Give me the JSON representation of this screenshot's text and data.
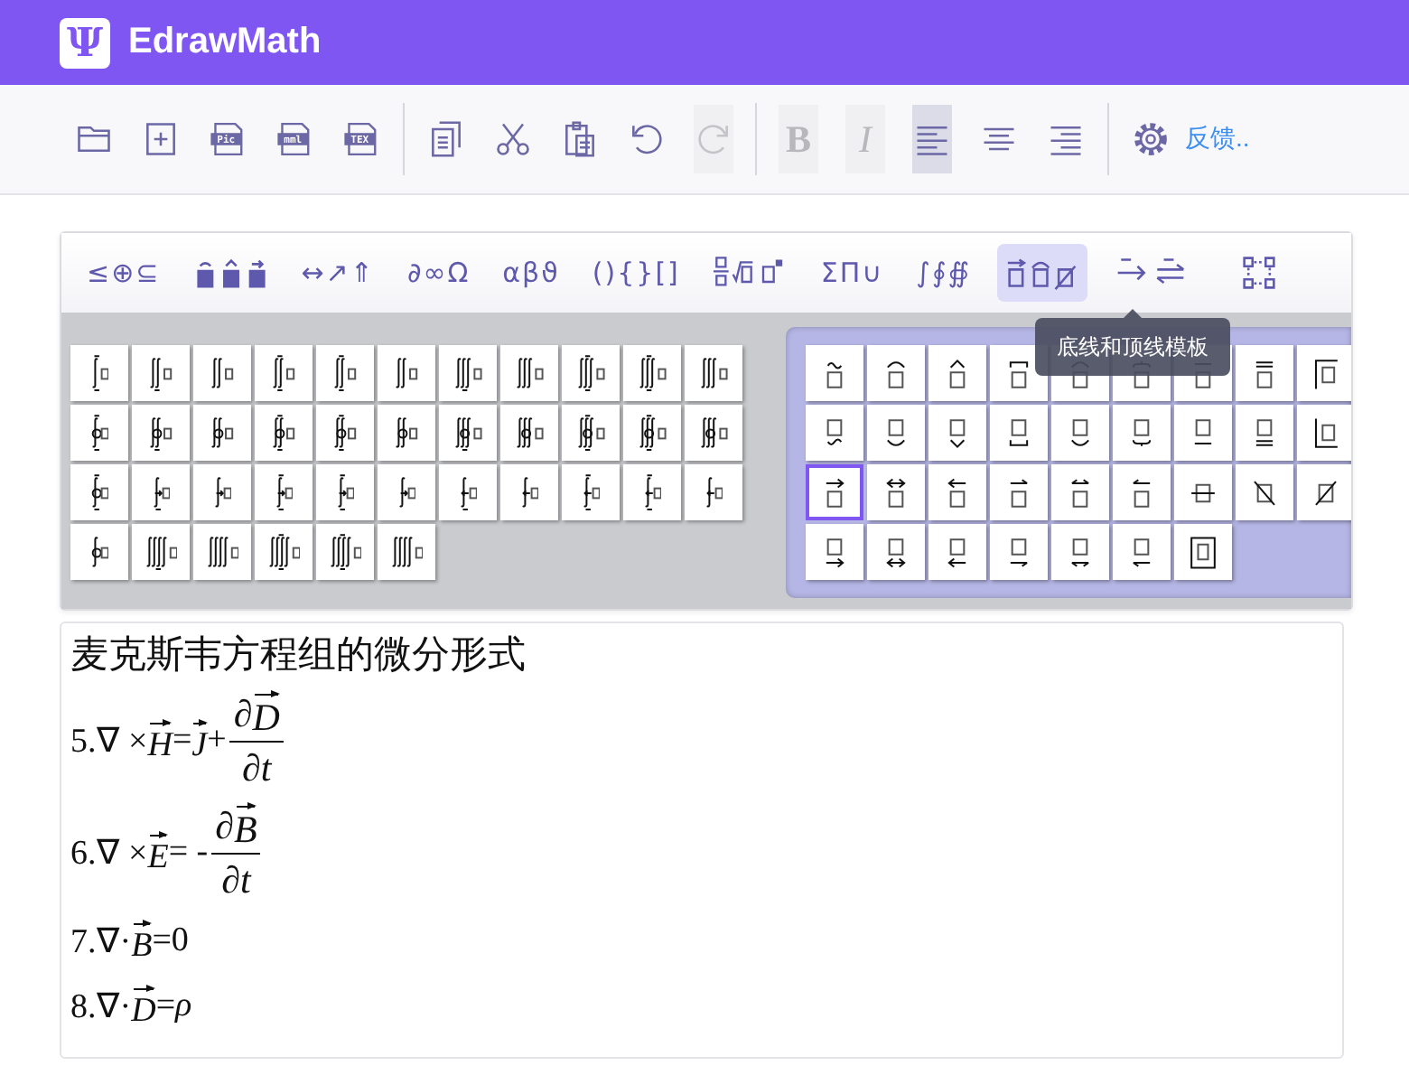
{
  "app": {
    "logo": "Ψ",
    "title": "EdrawMath"
  },
  "toolbar": {
    "tools": [
      {
        "kind": "open",
        "disabled": false
      },
      {
        "kind": "new",
        "disabled": false
      },
      {
        "kind": "export",
        "label": "Pic",
        "disabled": false
      },
      {
        "kind": "export",
        "label": "mml",
        "disabled": false
      },
      {
        "kind": "export",
        "label": "TEX",
        "disabled": false
      },
      {
        "kind": "separator"
      },
      {
        "kind": "copy",
        "disabled": false
      },
      {
        "kind": "cut",
        "disabled": false
      },
      {
        "kind": "paste",
        "disabled": false
      },
      {
        "kind": "undo",
        "disabled": false
      },
      {
        "kind": "redo",
        "disabled": true
      },
      {
        "kind": "separator"
      },
      {
        "kind": "bold",
        "label": "B",
        "disabled": true
      },
      {
        "kind": "italic",
        "label": "I",
        "disabled": true
      },
      {
        "kind": "align-left",
        "disabled": false,
        "selected": true
      },
      {
        "kind": "align-center",
        "disabled": false,
        "selected": false
      },
      {
        "kind": "align-right",
        "disabled": false,
        "selected": false
      },
      {
        "kind": "separator"
      },
      {
        "kind": "settings",
        "disabled": false
      }
    ],
    "feedback": "反馈.."
  },
  "symbol_tabs": [
    {
      "kind": "text",
      "label": "≤⊕⊆",
      "selected": false
    },
    {
      "kind": "accents",
      "selected": false
    },
    {
      "kind": "text",
      "label": "↔↗⇑",
      "selected": false
    },
    {
      "kind": "text",
      "label": "∂∞Ω",
      "selected": false
    },
    {
      "kind": "text",
      "label": "αβϑ",
      "selected": false
    },
    {
      "kind": "text",
      "label": "(){}[]",
      "selected": false
    },
    {
      "kind": "fractions",
      "selected": false
    },
    {
      "kind": "text",
      "label": "ΣΠ∪",
      "selected": false
    },
    {
      "kind": "text",
      "label": "∫∮∯",
      "selected": false
    },
    {
      "kind": "bars",
      "selected": true
    },
    {
      "kind": "labeled-arrows",
      "selected": false
    },
    {
      "kind": "matrices",
      "selected": false
    }
  ],
  "tooltip": "底线和顶线模板",
  "integral_templates": [
    {
      "selected": false
    },
    {
      "selected": false
    },
    {
      "selected": false
    },
    {
      "selected": false
    },
    {
      "selected": false
    },
    {
      "selected": false
    },
    {
      "selected": false
    },
    {
      "selected": false
    },
    {
      "selected": false
    },
    {
      "selected": false
    },
    {
      "selected": false
    },
    {
      "selected": false
    },
    {
      "selected": false
    },
    {
      "selected": false
    },
    {
      "selected": false
    },
    {
      "selected": false
    },
    {
      "selected": false
    },
    {
      "selected": false
    },
    {
      "selected": false
    },
    {
      "selected": false
    },
    {
      "selected": false
    },
    {
      "selected": false
    },
    {
      "selected": false
    },
    {
      "selected": false
    },
    {
      "selected": false
    },
    {
      "selected": false
    },
    {
      "selected": false
    },
    {
      "selected": false
    },
    {
      "selected": false
    },
    {
      "selected": false
    },
    {
      "selected": false
    },
    {
      "selected": false
    },
    {
      "selected": false
    },
    {
      "selected": false
    },
    {
      "selected": false
    },
    {
      "selected": false
    },
    {
      "selected": false
    },
    {
      "selected": false
    },
    {
      "selected": false
    }
  ],
  "bar_templates": [
    {
      "selected": false
    },
    {
      "selected": false
    },
    {
      "selected": false
    },
    {
      "selected": false
    },
    {
      "selected": false
    },
    {
      "selected": false
    },
    {
      "selected": false
    },
    {
      "selected": false
    },
    {
      "selected": false
    },
    {
      "selected": false
    },
    {
      "selected": false
    },
    {
      "selected": false
    },
    {
      "selected": false
    },
    {
      "selected": false
    },
    {
      "selected": false
    },
    {
      "selected": false
    },
    {
      "selected": false
    },
    {
      "selected": false
    },
    {
      "selected": true
    },
    {
      "selected": false
    },
    {
      "selected": false
    },
    {
      "selected": false
    },
    {
      "selected": false
    },
    {
      "selected": false
    },
    {
      "selected": false
    },
    {
      "selected": false
    },
    {
      "selected": false
    },
    {
      "selected": false
    },
    {
      "selected": false
    },
    {
      "selected": false
    },
    {
      "selected": false
    },
    {
      "selected": false
    },
    {
      "selected": false
    },
    {
      "selected": false
    }
  ],
  "document": {
    "heading": "麦克斯韦方程组的微分形式",
    "equations": [
      [
        {
          "kind": "text",
          "t": "5.∇ ×"
        },
        {
          "kind": "vec",
          "t": "H"
        },
        {
          "kind": "text",
          "t": "="
        },
        {
          "kind": "vec",
          "t": "J"
        },
        {
          "kind": "text",
          "t": " +"
        },
        {
          "kind": "frac",
          "num": [
            {
              "kind": "text",
              "t": "∂"
            },
            {
              "kind": "vec",
              "t": "D"
            }
          ],
          "den": [
            {
              "kind": "text",
              "t": "∂"
            },
            {
              "kind": "var",
              "t": "t"
            }
          ]
        }
      ],
      [
        {
          "kind": "text",
          "t": "6.∇ ×"
        },
        {
          "kind": "vec",
          "t": "E"
        },
        {
          "kind": "text",
          "t": "= -"
        },
        {
          "kind": "frac",
          "num": [
            {
              "kind": "text",
              "t": "∂"
            },
            {
              "kind": "vec",
              "t": "B"
            }
          ],
          "den": [
            {
              "kind": "text",
              "t": "∂"
            },
            {
              "kind": "var",
              "t": "t"
            }
          ]
        }
      ],
      [
        {
          "kind": "text",
          "t": "7.∇·"
        },
        {
          "kind": "vec",
          "t": "B"
        },
        {
          "kind": "text",
          "t": "=0"
        }
      ],
      [
        {
          "kind": "text",
          "t": "8.∇·"
        },
        {
          "kind": "vec",
          "t": "D"
        },
        {
          "kind": "text",
          "t": "="
        },
        {
          "kind": "var",
          "t": "ρ"
        }
      ]
    ]
  }
}
